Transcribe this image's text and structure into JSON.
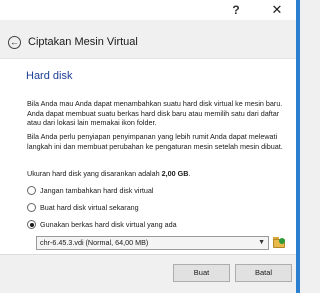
{
  "titlebar": {
    "help_label": "?",
    "close_label": "✕"
  },
  "header": {
    "back_icon": "back-arrow-icon",
    "title": "Ciptakan Mesin Virtual"
  },
  "section": {
    "title": "Hard disk",
    "para1": "Bila Anda mau Anda dapat menambahkan suatu hard disk virtual ke mesin baru. Anda dapat membuat suatu berkas hard disk baru atau memilih satu dari daftar atau dari lokasi lain memakai ikon folder.",
    "para2": "Bila Anda perlu penyiapan penyimpanan yang lebih rumit Anda dapat melewati langkah ini dan membuat perubahan ke pengaturan mesin setelah mesin dibuat.",
    "para3_prefix": "Ukuran hard disk yang disarankan adalah ",
    "para3_size": "2,00 GB",
    "para3_suffix": "."
  },
  "options": [
    {
      "label": "Jangan tambahkan hard disk virtual",
      "checked": false
    },
    {
      "label": "Buat hard disk virtual sekarang",
      "checked": false
    },
    {
      "label": "Gunakan berkas hard disk virtual yang ada",
      "checked": true
    }
  ],
  "vdi_select": {
    "value": "chr-6.45.3.vdi (Normal, 64,00 MB)",
    "arrow": "▼"
  },
  "folder_icon": "folder-open-icon",
  "buttons": {
    "create": "Buat",
    "cancel": "Batal"
  },
  "colors": {
    "section_title": "#1c3f95",
    "panel_bg": "#ffffff",
    "window_bg": "#f0f0f0"
  }
}
